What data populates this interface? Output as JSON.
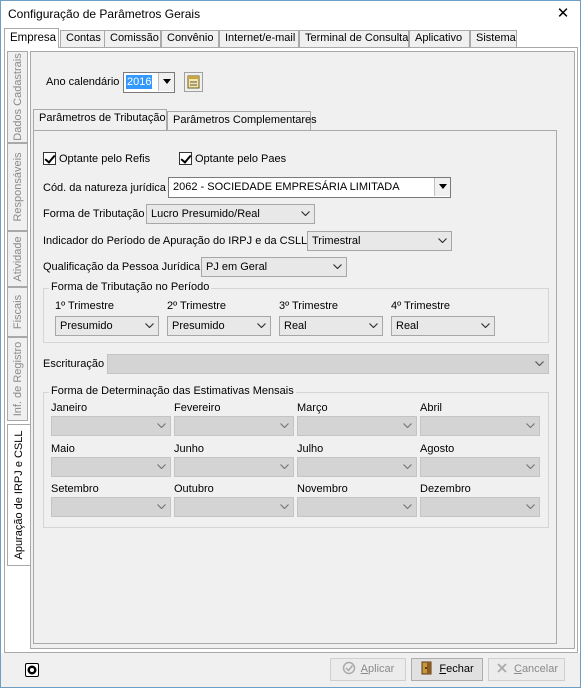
{
  "window": {
    "title": "Configuração de Parâmetros Gerais",
    "close_glyph": "✕"
  },
  "top_tabs": [
    "Empresa",
    "Contas",
    "Comissão",
    "Convênio",
    "Internet/e-mail",
    "Terminal de Consulta",
    "Aplicativo",
    "Sistema"
  ],
  "side_tabs": [
    "Dados Cadastrais",
    "Responsáveis",
    "Atividade",
    "Fiscais",
    "Inf. de Registro",
    "Apuração de IRPJ e CSLL"
  ],
  "ano": {
    "label": "Ano calendário",
    "value": "2016"
  },
  "sub_tabs": [
    "Parâmetros de Tributação",
    "Parâmetros Complementares"
  ],
  "form": {
    "refis": "Optante pelo Refis",
    "paes": "Optante pelo Paes",
    "natureza_label": "Cód. da natureza jurídica",
    "natureza_value": "2062 - SOCIEDADE EMPRESÁRIA LIMITADA",
    "forma_label": "Forma de Tributação",
    "forma_value": "Lucro Presumido/Real",
    "indicador_label": "Indicador do Período de Apuração do IRPJ e da CSLL",
    "indicador_value": "Trimestral",
    "qualificacao_label": "Qualificação da Pessoa Jurídica",
    "qualificacao_value": "PJ em Geral"
  },
  "periodo": {
    "title": "Forma de Tributação no Período",
    "trimestres": [
      {
        "label": "1º Trimestre",
        "value": "Presumido"
      },
      {
        "label": "2º Trimestre",
        "value": "Presumido"
      },
      {
        "label": "3º Trimestre",
        "value": "Real"
      },
      {
        "label": "4º Trimestre",
        "value": "Real"
      }
    ]
  },
  "escrituracao": {
    "label": "Escrituração",
    "value": ""
  },
  "estimativas": {
    "title": "Forma de Determinação das Estimativas Mensais",
    "months": [
      "Janeiro",
      "Fevereiro",
      "Março",
      "Abril",
      "Maio",
      "Junho",
      "Julho",
      "Agosto",
      "Setembro",
      "Outubro",
      "Novembro",
      "Dezembro"
    ]
  },
  "buttons": {
    "aplicar_u": "A",
    "aplicar_rest": "plicar",
    "fechar_u": "F",
    "fechar_rest": "echar",
    "cancelar_u": "C",
    "cancelar_rest": "ancelar"
  },
  "colors": {
    "accent": "#3399ff",
    "border": "#a9a9a9",
    "disabled": "#d4d4d4"
  }
}
